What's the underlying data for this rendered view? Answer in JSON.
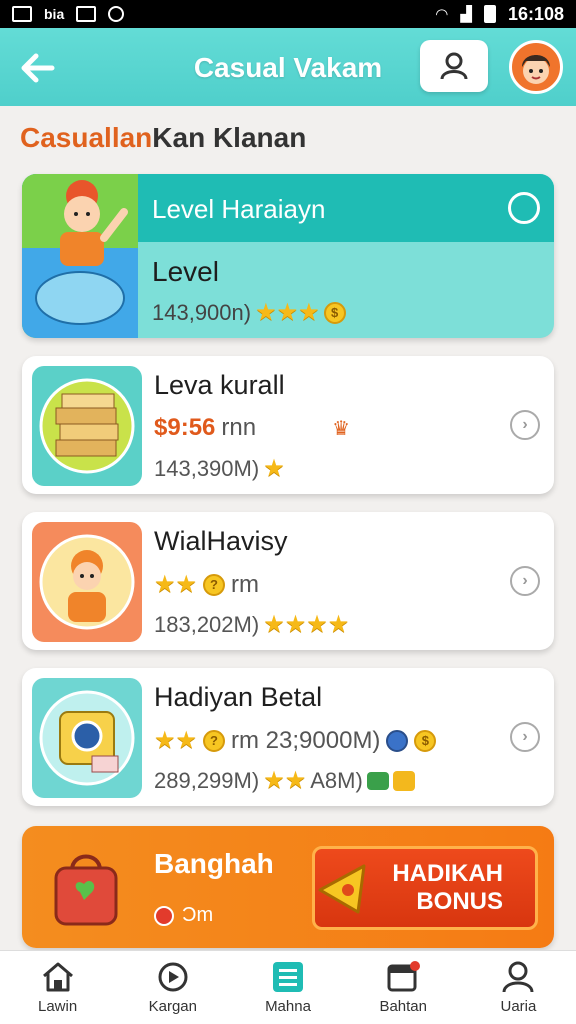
{
  "status_bar": {
    "carrier_text": "bia",
    "time": "16:108"
  },
  "app_bar": {
    "title": "Casual Vakam"
  },
  "section": {
    "title_part1": "Casuallan",
    "title_part2": "Kan Klanan"
  },
  "featured": {
    "header": "Level Haraiayn",
    "subtitle": "Level",
    "stats": "143,900n)",
    "stars": "★★★",
    "coin": "$"
  },
  "cards": [
    {
      "title": "Leva kurall",
      "price": "$9:56",
      "unit": "rnn",
      "stats": "143,390M)",
      "stars": "",
      "extra": ""
    },
    {
      "title": "WialHavisy",
      "price": "",
      "unit": "rm",
      "stars_top": "★★",
      "stats": "183,202M)",
      "stars": "★★★★"
    },
    {
      "title": "Hadiyan Betal",
      "stars_top": "★★",
      "unit": "rm 23;9000M)",
      "stats": "289,299M)",
      "stars": "★★",
      "extra": "A8M)"
    }
  ],
  "bonus": {
    "title": "Banghah",
    "sub": "Ɔm",
    "button_line1": "HADIKAH",
    "button_line2": "BONUS"
  },
  "bottom_nav": [
    {
      "label": "Lawin",
      "icon": "home-icon"
    },
    {
      "label": "Kargan",
      "icon": "compass-icon"
    },
    {
      "label": "Mahna",
      "icon": "list-icon"
    },
    {
      "label": "Bahtan",
      "icon": "calendar-icon"
    },
    {
      "label": "Uaria",
      "icon": "person-icon"
    }
  ],
  "colors": {
    "teal": "#4fcfcb",
    "teal_dark": "#1fbcb4",
    "orange": "#f48d1f",
    "accent": "#e05a1c"
  }
}
